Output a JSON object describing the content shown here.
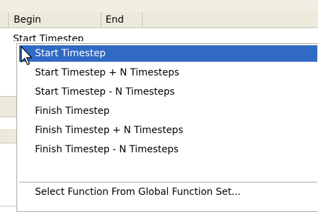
{
  "table": {
    "columns": [
      "Begin",
      "End"
    ],
    "cell_text": "Start Timestep"
  },
  "menu": {
    "items": [
      "Start Timestep",
      "Start Timestep + N Timesteps",
      "Start Timestep - N Timesteps",
      "Finish Timestep",
      "Finish Timestep + N Timesteps",
      "Finish Timestep - N Timesteps"
    ],
    "selected_index": 0,
    "extra_item": "Select Function From Global Function Set..."
  },
  "colors": {
    "selection": "#316ac5",
    "header_bg": "#ebeadb",
    "border": "#aca899"
  }
}
